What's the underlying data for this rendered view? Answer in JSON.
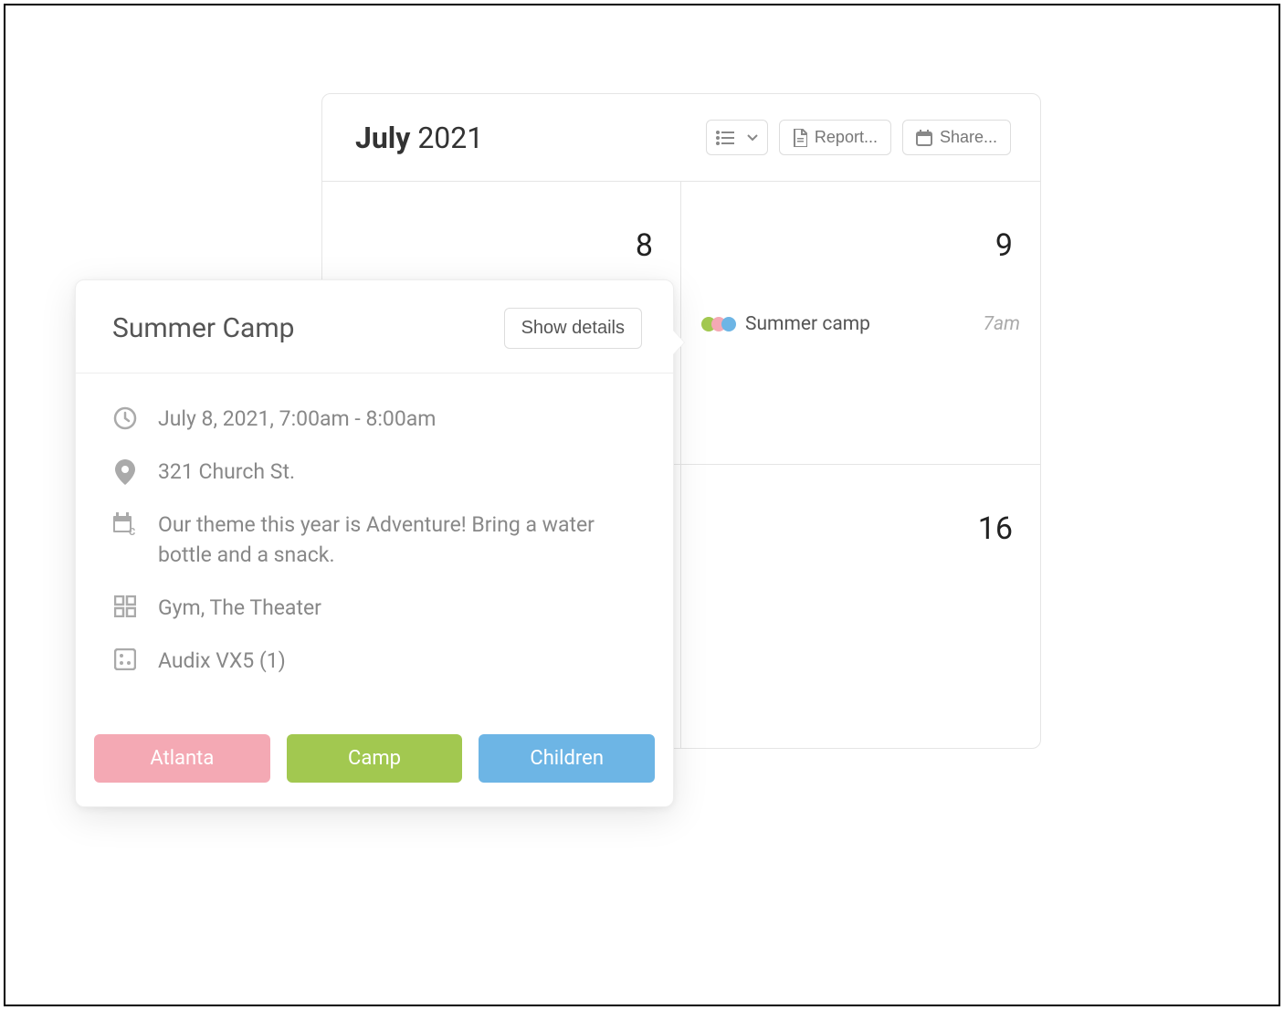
{
  "header": {
    "month_bold": "July",
    "year": "2021",
    "report_label": "Report...",
    "share_label": "Share..."
  },
  "days": {
    "d8": "8",
    "d9": "9",
    "d16": "16"
  },
  "event": {
    "name": "Summer camp",
    "time": "7am"
  },
  "popover": {
    "title": "Summer Camp",
    "show_details": "Show details",
    "datetime": "July 8, 2021, 7:00am - 8:00am",
    "location": "321 Church St.",
    "description": "Our theme this year is Adventure! Bring a water bottle and a snack.",
    "rooms": "Gym, The Theater",
    "resources": "Audix VX5 (1)",
    "tags": {
      "atlanta": "Atlanta",
      "camp": "Camp",
      "children": "Children"
    }
  },
  "tag_colors": {
    "atlanta": "#f4a9b4",
    "camp": "#a2c850",
    "children": "#6db5e5"
  }
}
